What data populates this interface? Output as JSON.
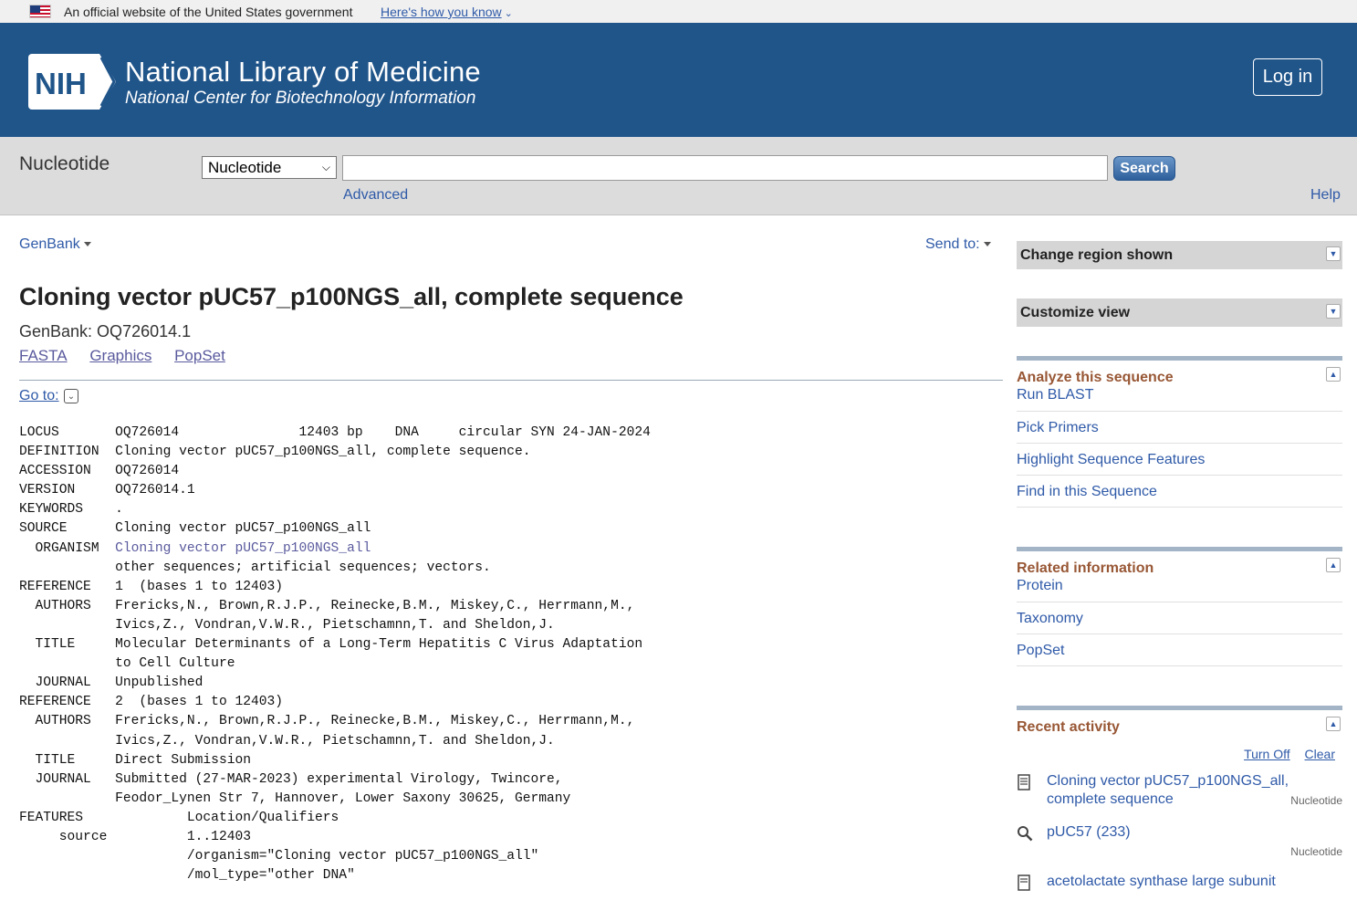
{
  "gov_banner": {
    "text": "An official website of the United States government",
    "link": "Here's how you know"
  },
  "header": {
    "logo_text": "NIH",
    "title": "National Library of Medicine",
    "subtitle": "National Center for Biotechnology Information",
    "login": "Log in"
  },
  "search": {
    "db_name": "Nucleotide",
    "db_select": "Nucleotide",
    "query": "",
    "button": "Search",
    "advanced": "Advanced",
    "help": "Help"
  },
  "record": {
    "format_menu": "GenBank",
    "send_to": "Send to:",
    "title": "Cloning vector pUC57_p100NGS_all, complete sequence",
    "accession": "GenBank: OQ726014.1",
    "links": [
      "FASTA",
      "Graphics",
      "PopSet"
    ],
    "goto": "Go to:"
  },
  "flatfile": [
    "LOCUS       OQ726014               12403 bp    DNA     circular SYN 24-JAN-2024",
    "DEFINITION  Cloning vector pUC57_p100NGS_all, complete sequence.",
    "ACCESSION   OQ726014",
    "VERSION     OQ726014.1",
    "KEYWORDS    .",
    "SOURCE      Cloning vector pUC57_p100NGS_all",
    "  ORGANISM  ",
    "            other sequences; artificial sequences; vectors.",
    "REFERENCE   1  (bases 1 to 12403)",
    "  AUTHORS   Frericks,N., Brown,R.J.P., Reinecke,B.M., Miskey,C., Herrmann,M.,",
    "            Ivics,Z., Vondran,V.W.R., Pietschamnn,T. and Sheldon,J.",
    "  TITLE     Molecular Determinants of a Long-Term Hepatitis C Virus Adaptation",
    "            to Cell Culture",
    "  JOURNAL   Unpublished",
    "REFERENCE   2  (bases 1 to 12403)",
    "  AUTHORS   Frericks,N., Brown,R.J.P., Reinecke,B.M., Miskey,C., Herrmann,M.,",
    "            Ivics,Z., Vondran,V.W.R., Pietschamnn,T. and Sheldon,J.",
    "  TITLE     Direct Submission",
    "  JOURNAL   Submitted (27-MAR-2023) experimental Virology, Twincore,",
    "            Feodor_Lynen Str 7, Hannover, Lower Saxony 30625, Germany",
    "FEATURES             Location/Qualifiers",
    "     source          1..12403",
    "                     /organism=\"Cloning vector pUC57_p100NGS_all\"",
    "                     /mol_type=\"other DNA\""
  ],
  "organism_link": "Cloning vector pUC57_p100NGS_all",
  "sidebar": {
    "change_region": "Change region shown",
    "customize_view": "Customize view",
    "analyze": {
      "title": "Analyze this sequence",
      "items": [
        "Run BLAST",
        "Pick Primers",
        "Highlight Sequence Features",
        "Find in this Sequence"
      ]
    },
    "related": {
      "title": "Related information",
      "items": [
        "Protein",
        "Taxonomy",
        "PopSet"
      ]
    },
    "recent": {
      "title": "Recent activity",
      "turn_off": "Turn Off",
      "clear": "Clear",
      "items": [
        {
          "label": "Cloning vector pUC57_p100NGS_all, complete sequence",
          "db": "Nucleotide",
          "icon": "document-icon"
        },
        {
          "label": "pUC57 (233)",
          "db": "Nucleotide",
          "icon": "search-icon"
        },
        {
          "label": "acetolactate synthase large subunit",
          "db": "",
          "icon": "document-icon"
        }
      ]
    }
  },
  "colors": {
    "header_bg": "#20558a",
    "link": "#2f5aa8",
    "portlet_title": "#985735"
  }
}
